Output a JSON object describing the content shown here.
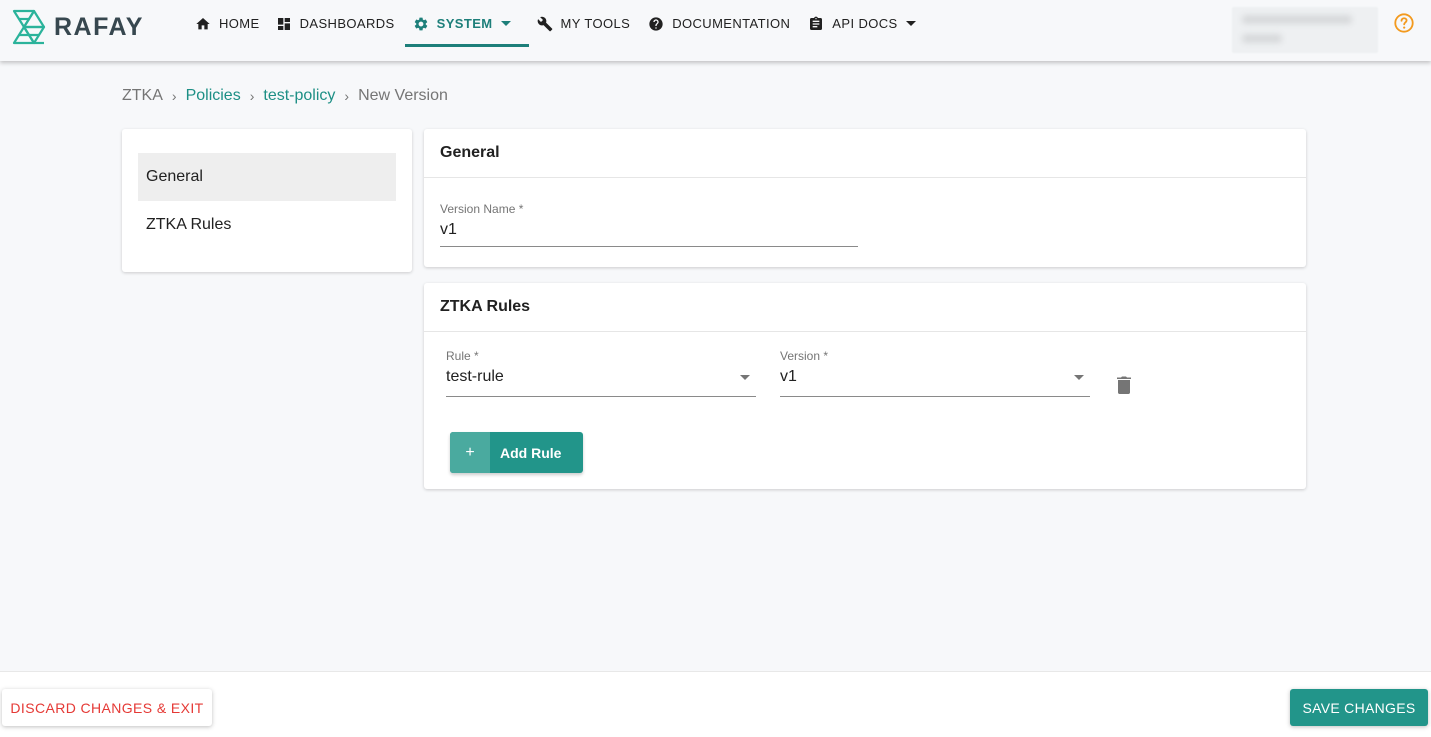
{
  "brand": {
    "name": "RAFAY",
    "accent": "#1d7f7a",
    "logo_color": "#2bb39b"
  },
  "nav": {
    "items": [
      {
        "label": "HOME",
        "icon": "home-icon"
      },
      {
        "label": "DASHBOARDS",
        "icon": "dashboard-icon"
      },
      {
        "label": "SYSTEM",
        "icon": "gear-icon",
        "active": true,
        "has_dropdown": true
      },
      {
        "label": "MY TOOLS",
        "icon": "wrench-icon"
      },
      {
        "label": "DOCUMENTATION",
        "icon": "help-circle-icon"
      },
      {
        "label": "API DOCS",
        "icon": "clipboard-icon",
        "has_dropdown": true
      }
    ],
    "help_icon": "help-outline-icon"
  },
  "breadcrumb": {
    "items": [
      {
        "label": "ZTKA",
        "link": false
      },
      {
        "label": "Policies",
        "link": true
      },
      {
        "label": "test-policy",
        "link": true
      },
      {
        "label": "New Version",
        "link": false
      }
    ],
    "separator": "›"
  },
  "sidenav": {
    "items": [
      {
        "label": "General",
        "selected": true
      },
      {
        "label": "ZTKA Rules",
        "selected": false
      }
    ]
  },
  "general": {
    "title": "General",
    "version_name": {
      "label": "Version Name *",
      "value": "v1"
    }
  },
  "rules": {
    "title": "ZTKA Rules",
    "rows": [
      {
        "rule": {
          "label": "Rule *",
          "value": "test-rule"
        },
        "version": {
          "label": "Version *",
          "value": "v1"
        }
      }
    ],
    "add_button": {
      "icon": "+",
      "label": "Add Rule"
    }
  },
  "footer": {
    "discard_label": "DISCARD CHANGES & EXIT",
    "save_label": "SAVE CHANGES",
    "discard_color": "#e53935",
    "save_color": "#22958a"
  }
}
